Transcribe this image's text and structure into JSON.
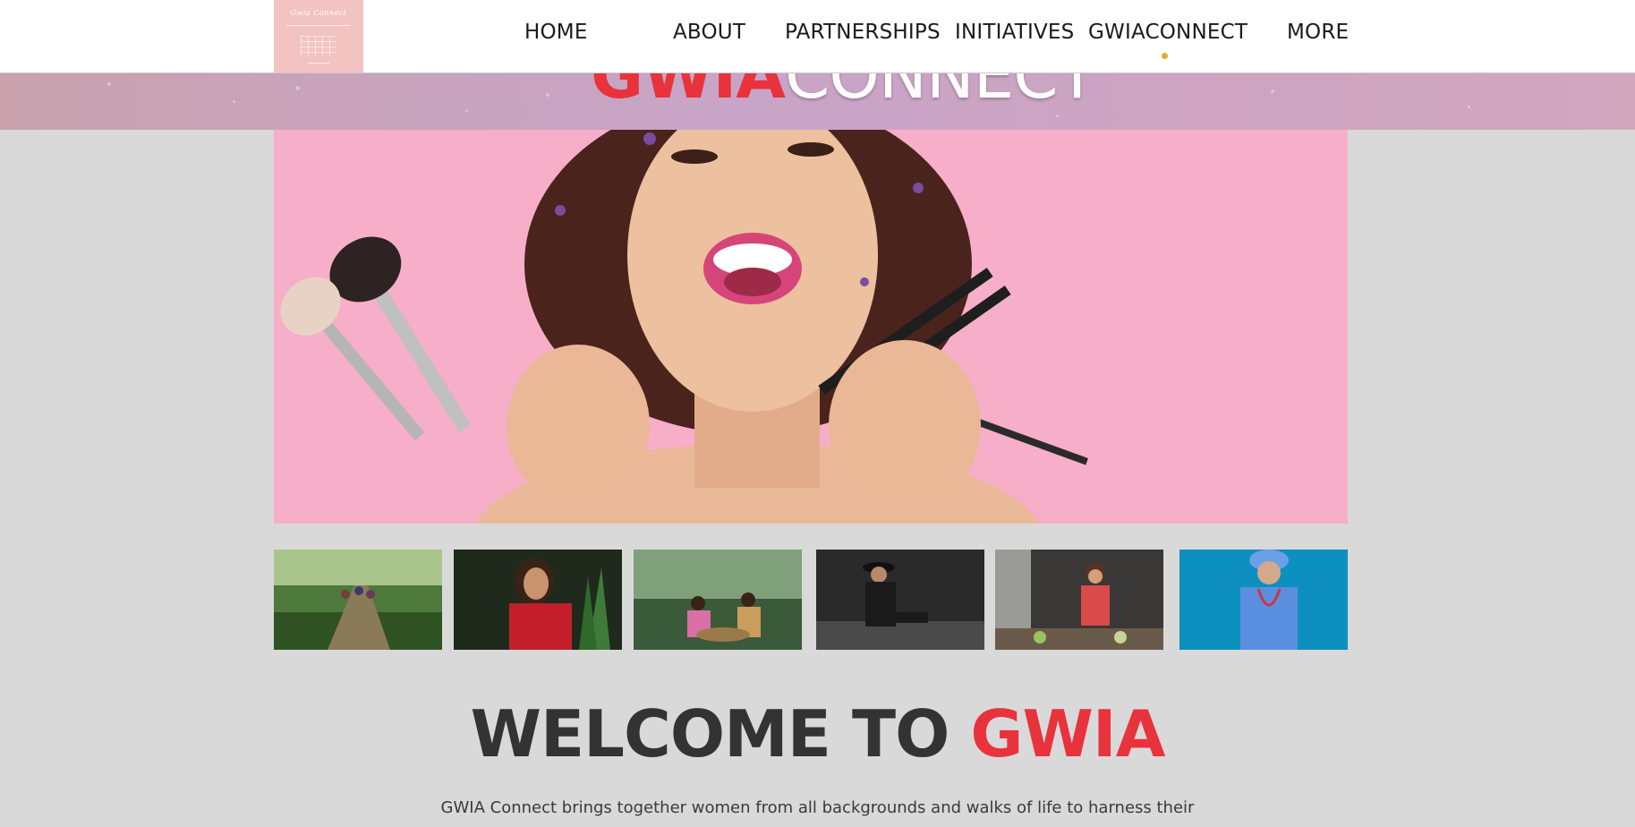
{
  "header": {
    "logo_text": "Gwia Connect",
    "nav": [
      {
        "label": "HOME"
      },
      {
        "label": "ABOUT"
      },
      {
        "label": "PARTNERSHIPS"
      },
      {
        "label": "INITIATIVES"
      },
      {
        "label": "GWIACONNECT"
      },
      {
        "label": "MORE"
      }
    ],
    "active_nav": "GWIACONNECT",
    "active_dot_color": "#e0b02b"
  },
  "banner": {
    "title_red": "GWIA",
    "title_white": "CONNECT"
  },
  "hero": {
    "image": "smiling woman holding makeup brushes on pink background"
  },
  "gallery": [
    {
      "image": "women walking on rural path"
    },
    {
      "image": "woman in red dress with plants"
    },
    {
      "image": "two women weaving in forest"
    },
    {
      "image": "person in hat crouching on dark background"
    },
    {
      "image": "woman cooking in kitchen"
    },
    {
      "image": "doctor in blue scrubs with stethoscope"
    }
  ],
  "welcome": {
    "prefix": "WELCOME TO ",
    "highlight": "GWIA",
    "intro": "GWIA Connect brings together women from all backgrounds and walks of life to harness their"
  },
  "colors": {
    "accent_red": "#e8333c",
    "background": "#d9d9d9",
    "hero_pink": "#f7aec8"
  }
}
